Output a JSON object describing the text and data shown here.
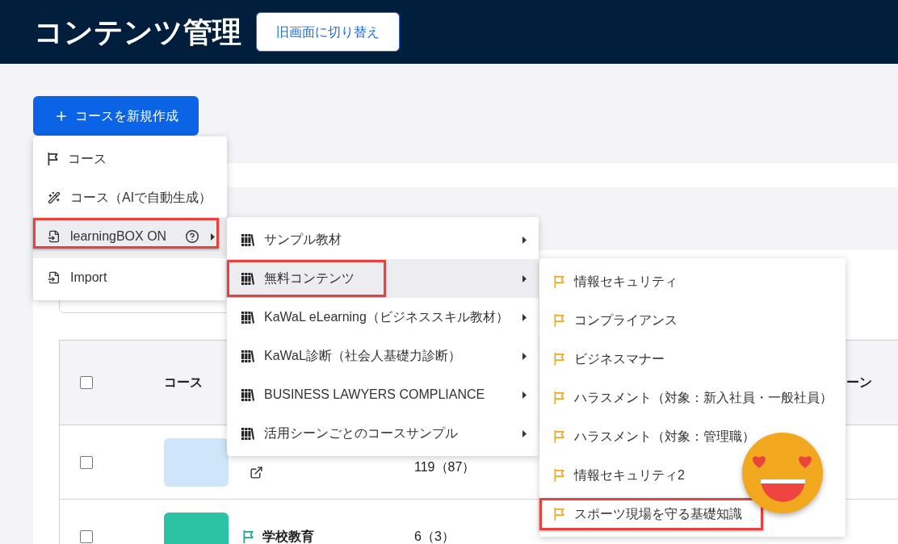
{
  "header": {
    "title": "コンテンツ管理",
    "switch_button": "旧画面に切り替え"
  },
  "create_button": {
    "label": "コースを新規作成"
  },
  "table": {
    "header": {
      "checked": false,
      "course": "コース",
      "column_6": "ーン"
    },
    "rows": [
      {
        "kind": "linked",
        "checked": false,
        "count": "119（87）"
      },
      {
        "kind": "course",
        "checked": false,
        "title": "学校教育",
        "count": "6（3）"
      }
    ]
  },
  "menus": [
    {
      "items": [
        {
          "kind": "new_course",
          "label": "コース",
          "selected": false,
          "marked": false,
          "separated": false
        },
        {
          "kind": "ai_course",
          "label": "コース（AIで自動生成）",
          "selected": false,
          "marked": false,
          "separated": false
        },
        {
          "kind": "library",
          "label": "learningBOX ON",
          "selected": true,
          "marked": true,
          "separated": false
        },
        {
          "kind": "import",
          "label": "Import",
          "selected": false,
          "marked": false,
          "separated": true
        }
      ]
    },
    {
      "items": [
        {
          "kind": "collection",
          "label": "サンプル教材",
          "selected": false,
          "marked": false,
          "separated": false
        },
        {
          "kind": "collection",
          "label": "無料コンテンツ",
          "selected": true,
          "marked": true,
          "separated": false
        },
        {
          "kind": "collection",
          "label": "KaWaL eLearning（ビジネススキル教材）",
          "selected": false,
          "marked": false,
          "separated": false
        },
        {
          "kind": "collection",
          "label": "KaWaL診断（社会人基礎力診断）",
          "selected": false,
          "marked": false,
          "separated": false
        },
        {
          "kind": "collection",
          "label": "BUSINESS LAWYERS COMPLIANCE",
          "selected": false,
          "marked": false,
          "separated": false
        },
        {
          "kind": "collection",
          "label": "活用シーンごとのコースサンプル",
          "selected": false,
          "marked": false,
          "separated": false
        }
      ]
    },
    {
      "items": [
        {
          "kind": "content",
          "label": "情報セキュリティ",
          "selected": false,
          "marked": false,
          "separated": false
        },
        {
          "kind": "content",
          "label": "コンプライアンス",
          "selected": false,
          "marked": false,
          "separated": false
        },
        {
          "kind": "content",
          "label": "ビジネスマナー",
          "selected": false,
          "marked": false,
          "separated": false
        },
        {
          "kind": "content",
          "label": "ハラスメント（対象：新入社員・一般社員）",
          "selected": false,
          "marked": false,
          "separated": false
        },
        {
          "kind": "content",
          "label": "ハラスメント（対象：管理職）",
          "selected": false,
          "marked": false,
          "separated": false
        },
        {
          "kind": "content",
          "label": "情報セキュリティ2",
          "selected": false,
          "marked": false,
          "separated": false
        },
        {
          "kind": "content",
          "label": "スポーツ現場を守る基礎知識",
          "selected": false,
          "marked": true,
          "separated": false
        }
      ]
    }
  ]
}
